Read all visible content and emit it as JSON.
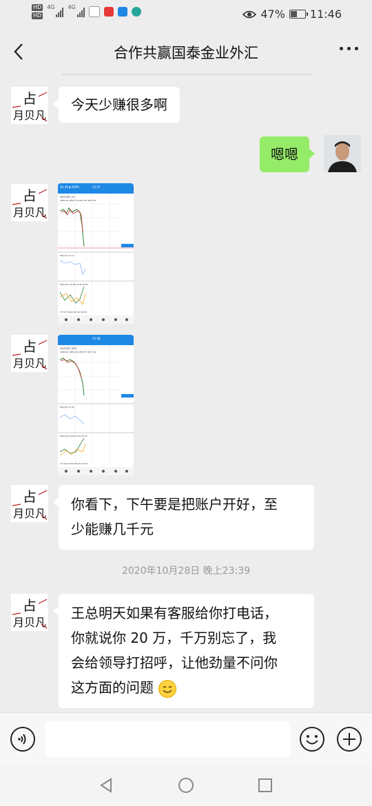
{
  "status_bar": {
    "hd1": "HD",
    "hd2": "HD",
    "net1": "4G",
    "net2": "4G",
    "battery": "47%",
    "battery_level": 0.47,
    "time": "11:46"
  },
  "header": {
    "title": "合作共赢国泰金业外汇"
  },
  "avatar_text": {
    "line1": "占",
    "line2": "月贝凡"
  },
  "messages": [
    {
      "side": "left",
      "text": "今天少赚很多啊"
    },
    {
      "side": "right",
      "text": "嗯嗯"
    },
    {
      "side": "left",
      "type": "image"
    },
    {
      "side": "left",
      "type": "image"
    },
    {
      "side": "left",
      "text": "你看下，下午要是把账户开好，至少能赚几千元"
    },
    {
      "side": "left",
      "text": "王总明天如果有客服给你打电话，你就说你 20 万，千万别忘了，我会给领导打招呼，让他劲量不问你这方面的问题"
    }
  ],
  "msg_lines": {
    "m5": [
      "你看下，下午要是把账户开好，至",
      "少能赚几千元"
    ],
    "m6": [
      "王总明天如果有客服给你打电话，",
      "你就说你 20 万，千万别忘了，我",
      "会给领导打招呼，让他劲量不问你",
      "这方面的问题"
    ]
  },
  "timestamp": "2020年10月28日 晚上23:39",
  "screenshots": {
    "s1": {
      "symbol": "XAUUSD, H1",
      "quote": "1881.62 1881.74 1870.30 1870.25",
      "rsi": "RSI(14) 71.13",
      "adx": "ADX(14) 24.48 17.93 45.87",
      "dates": "27 Oct 2020    28 Oct 08:00",
      "time": "23:47"
    },
    "s2": {
      "symbol": "XAUUSD, M30",
      "quote": "1880.61 1881.20 1876.75 1877.22",
      "rsi": "RSI(14) 71.50",
      "adx": "ADX(14) 10.84 6.03 47.32",
      "dates": "27 Oct 23:00    28 Oct 12:00",
      "time": "23:48"
    }
  },
  "colors": {
    "bubble_right": "#95ec69",
    "bubble_left": "#ffffff",
    "background": "#ededed",
    "chart_header": "#1e88e5"
  },
  "icons": {
    "back": "chevron-left-icon",
    "more": "more-dots-icon",
    "voice": "voice-icon",
    "emoji": "emoji-icon",
    "plus": "plus-icon"
  }
}
